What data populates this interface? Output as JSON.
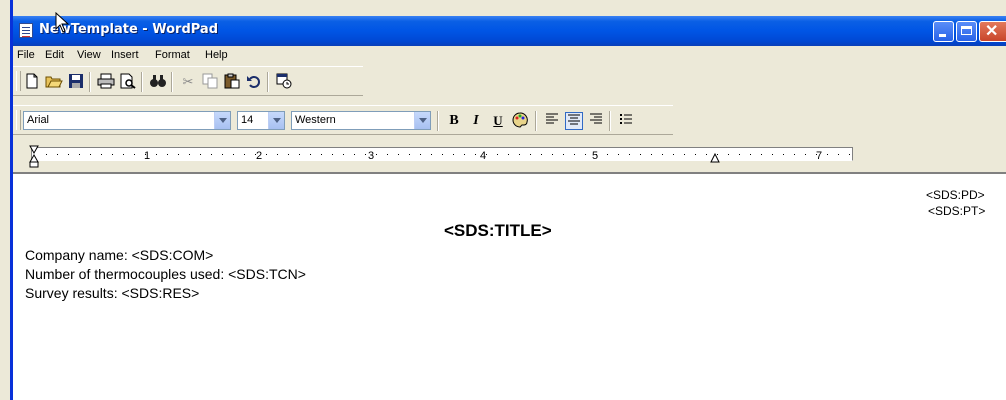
{
  "window": {
    "title": "NewTemplate - WordPad",
    "controls": {
      "minimize": "minimize",
      "maximize": "maximize",
      "close": "close"
    }
  },
  "menu": [
    "File",
    "Edit",
    "View",
    "Insert",
    "Format",
    "Help"
  ],
  "toolbar": {
    "icons": [
      "new-icon",
      "open-icon",
      "save-icon",
      "print-icon",
      "print-preview-icon",
      "find-icon",
      "cut-icon",
      "copy-icon",
      "paste-icon",
      "undo-icon",
      "insert-datetime-icon"
    ]
  },
  "format_bar": {
    "font": "Arial",
    "size": "14",
    "script": "Western",
    "bold": "B",
    "italic": "I",
    "underline": "U",
    "align_center_active": true
  },
  "ruler": {
    "labels": [
      "1",
      "2",
      "3",
      "4",
      "5",
      "7"
    ]
  },
  "document": {
    "header_right_1": "<SDS:PD>",
    "header_right_2": "<SDS:PT>",
    "title": "<SDS:TITLE>",
    "lines": [
      "Company name: <SDS:COM>",
      "Number of thermocouples used: <SDS:TCN>",
      "Survey results: <SDS:RES>"
    ]
  },
  "colors": {
    "titlebar": "#0055e5",
    "face": "#ece9d8",
    "accent_border": "#0831d9"
  }
}
